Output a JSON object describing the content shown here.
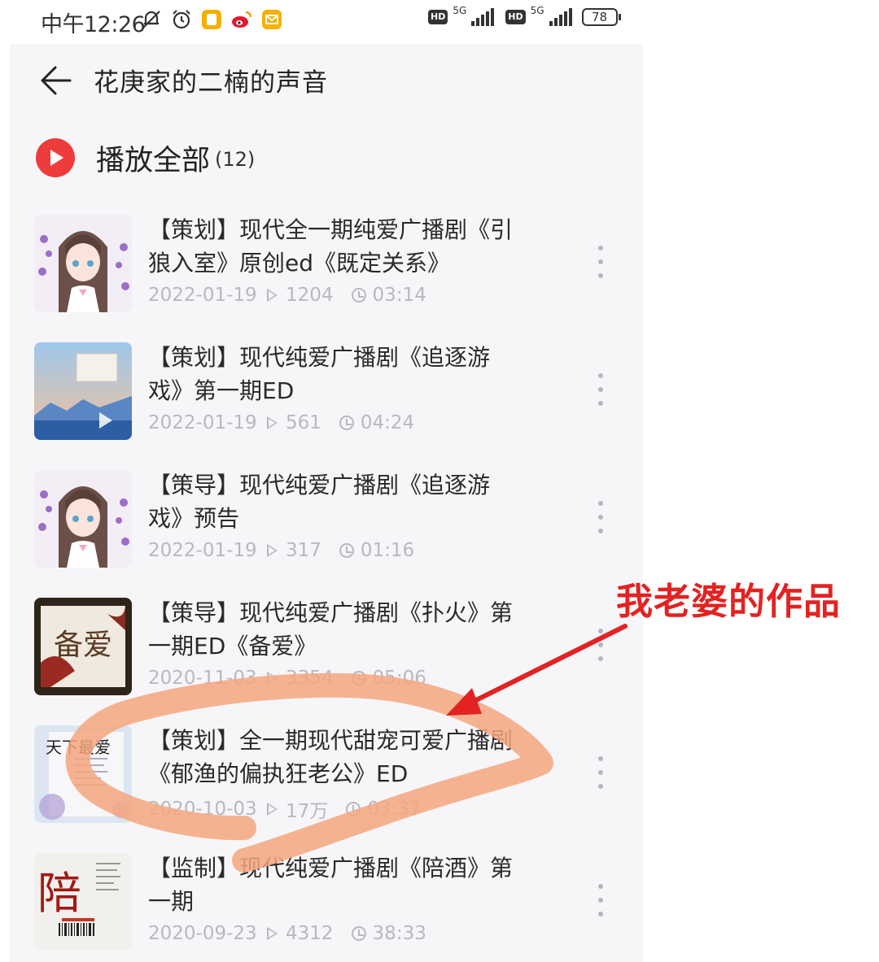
{
  "status_bar": {
    "time": "中午12:26",
    "network_1": "5G",
    "network_2": "5G",
    "hd_1": "HD",
    "hd_2": "HD",
    "battery": "78"
  },
  "header": {
    "title": "花庚家的二楠的声音"
  },
  "playall": {
    "label": "播放全部",
    "count": "(12)"
  },
  "items": [
    {
      "title_line1": "【策划】现代全一期纯爱广播剧《引",
      "title_line2": "狼入室》原创ed《既定关系》",
      "date": "2022-01-19",
      "plays": "1204",
      "duration": "03:14"
    },
    {
      "title_line1": "【策划】现代纯爱广播剧《追逐游",
      "title_line2": "戏》第一期ED",
      "date": "2022-01-19",
      "plays": "561",
      "duration": "04:24"
    },
    {
      "title_line1": "【策导】现代纯爱广播剧《追逐游",
      "title_line2": "戏》预告",
      "date": "2022-01-19",
      "plays": "317",
      "duration": "01:16"
    },
    {
      "title_line1": "【策导】现代纯爱广播剧《扑火》第",
      "title_line2": "一期ED《备爱》",
      "date": "2020-11-03",
      "plays": "3354",
      "duration": "05:06",
      "cover_text": "备爱"
    },
    {
      "title_line1": "【策划】全一期现代甜宠可爱广播剧",
      "title_line2": "《郁渔的偏执狂老公》ED",
      "date": "2020-10-03",
      "plays": "17万",
      "duration": "03:37",
      "cover_text": "天下最爱"
    },
    {
      "title_line1": "【监制】现代纯爱广播剧《陪酒》第",
      "title_line2": "一期",
      "date": "2020-09-23",
      "plays": "4312",
      "duration": "38:33",
      "cover_text": "陪"
    }
  ],
  "annotation": {
    "text": "我老婆的作品",
    "color": "#e32222",
    "highlight_color": "#f5a67f"
  }
}
